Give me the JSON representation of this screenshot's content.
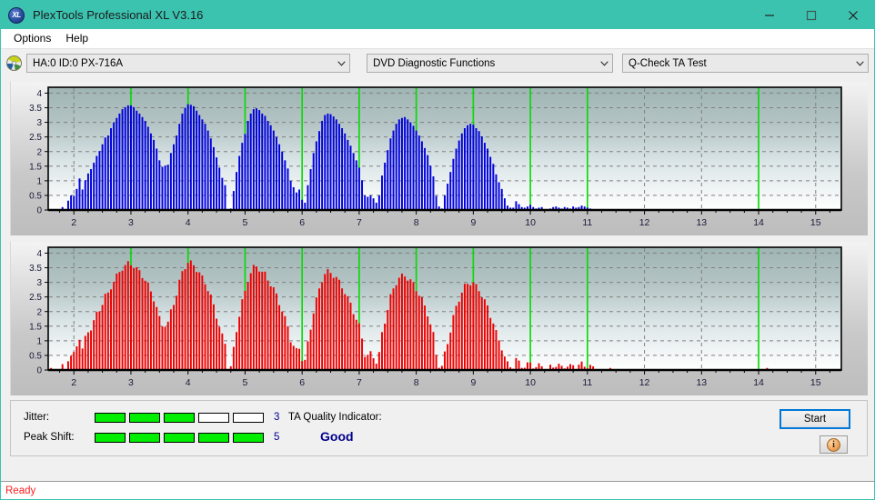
{
  "window": {
    "title": "PlexTools Professional XL V3.16",
    "app_icon": "xl-logo-icon",
    "minimize_label": "minimize-icon",
    "maximize_label": "maximize-icon",
    "close_label": "close-icon"
  },
  "menubar": {
    "items": [
      {
        "label": "Options"
      },
      {
        "label": "Help"
      }
    ]
  },
  "toolbar": {
    "drive_icon": "disc-icon",
    "drive": {
      "value": "HA:0 ID:0  PX-716A"
    },
    "function": {
      "value": "DVD Diagnostic Functions"
    },
    "test": {
      "value": "Q-Check TA Test"
    }
  },
  "results": {
    "jitter_label": "Jitter:",
    "jitter_value": "3",
    "jitter_filled": 3,
    "jitter_total": 5,
    "peak_shift_label": "Peak Shift:",
    "peak_shift_value": "5",
    "peak_shift_filled": 5,
    "peak_shift_total": 5,
    "ta_quality_label": "TA Quality Indicator:",
    "ta_quality_value": "Good",
    "start_label": "Start",
    "info_label": "i",
    "bar_on_color": "#00ee00",
    "bar_off_color": "#ffffff",
    "value_color": "#00008b"
  },
  "statusbar": {
    "text": "Ready"
  },
  "chart_data": [
    {
      "id": "ta-test-top",
      "type": "bar",
      "title": "",
      "xlabel": "",
      "ylabel": "",
      "series_color": "#0000dd",
      "marker_color": "#00dd00",
      "markers": [
        3,
        4,
        5,
        6,
        7,
        8,
        9,
        10,
        11,
        14
      ],
      "grid": true,
      "xlim": [
        1.55,
        15.45
      ],
      "ylim": [
        0,
        4.2
      ],
      "xticks": [
        2,
        3,
        4,
        5,
        6,
        7,
        8,
        9,
        10,
        11,
        12,
        13,
        14,
        15
      ],
      "yticks": [
        0,
        0.5,
        1,
        1.5,
        2,
        2.5,
        3,
        3.5,
        4
      ],
      "ytick_labels": [
        "0",
        "0.5",
        "1",
        "1.5",
        "2",
        "2.5",
        "3",
        "3.5",
        "4"
      ],
      "x": [
        1.6,
        1.65,
        1.7,
        1.75,
        1.8,
        1.85,
        1.9,
        1.95,
        2.0,
        2.05,
        2.1,
        2.15,
        2.2,
        2.25,
        2.3,
        2.35,
        2.4,
        2.45,
        2.5,
        2.55,
        2.6,
        2.65,
        2.7,
        2.75,
        2.8,
        2.85,
        2.9,
        2.95,
        3.0,
        3.05,
        3.1,
        3.15,
        3.2,
        3.25,
        3.3,
        3.35,
        3.4,
        3.45,
        3.5,
        3.55,
        3.6,
        3.65,
        3.7,
        3.75,
        3.8,
        3.85,
        3.9,
        3.95,
        4.0,
        4.05,
        4.1,
        4.15,
        4.2,
        4.25,
        4.3,
        4.35,
        4.4,
        4.45,
        4.5,
        4.55,
        4.6,
        4.65,
        4.7,
        4.75,
        4.8,
        4.85,
        4.9,
        4.95,
        5.0,
        5.05,
        5.1,
        5.15,
        5.2,
        5.25,
        5.3,
        5.35,
        5.4,
        5.45,
        5.5,
        5.55,
        5.6,
        5.65,
        5.7,
        5.75,
        5.8,
        5.85,
        5.9,
        5.95,
        6.0,
        6.05,
        6.1,
        6.15,
        6.2,
        6.25,
        6.3,
        6.35,
        6.4,
        6.45,
        6.5,
        6.55,
        6.6,
        6.65,
        6.7,
        6.75,
        6.8,
        6.85,
        6.9,
        6.95,
        7.0,
        7.05,
        7.1,
        7.15,
        7.2,
        7.25,
        7.3,
        7.35,
        7.4,
        7.45,
        7.5,
        7.55,
        7.6,
        7.65,
        7.7,
        7.75,
        7.8,
        7.85,
        7.9,
        7.95,
        8.0,
        8.05,
        8.1,
        8.15,
        8.2,
        8.25,
        8.3,
        8.35,
        8.4,
        8.45,
        8.5,
        8.55,
        8.6,
        8.65,
        8.7,
        8.75,
        8.8,
        8.85,
        8.9,
        8.95,
        9.0,
        9.05,
        9.1,
        9.15,
        9.2,
        9.25,
        9.3,
        9.35,
        9.4,
        9.45,
        9.5,
        9.55,
        9.6,
        9.65,
        9.7,
        9.75,
        9.8,
        9.85,
        9.9,
        9.95,
        10.0,
        10.05,
        10.1,
        10.15,
        10.2,
        10.25,
        10.3,
        10.35,
        10.4,
        10.45,
        10.5,
        10.55,
        10.6,
        10.65,
        10.7,
        10.75,
        10.8,
        10.85,
        10.9,
        10.95,
        11.0,
        11.05,
        11.1,
        11.15,
        11.2,
        11.25,
        11.3,
        11.35,
        11.4,
        13.85,
        13.9,
        13.95,
        14.0,
        14.05,
        14.1,
        14.15,
        14.2
      ],
      "values": [
        0,
        0,
        0,
        0,
        0.1,
        0.0,
        0.32,
        0.5,
        0.48,
        0.72,
        1.08,
        0.7,
        1.02,
        1.25,
        1.4,
        1.62,
        1.85,
        2.02,
        2.25,
        2.48,
        2.55,
        2.8,
        3.0,
        3.15,
        3.3,
        3.45,
        3.52,
        3.58,
        3.58,
        3.52,
        3.4,
        3.3,
        3.18,
        3.05,
        2.85,
        2.62,
        2.4,
        2.1,
        1.7,
        1.48,
        1.52,
        1.55,
        1.95,
        2.25,
        2.55,
        2.95,
        3.3,
        3.5,
        3.62,
        3.6,
        3.55,
        3.4,
        3.25,
        3.1,
        2.95,
        2.72,
        2.45,
        2.15,
        1.8,
        1.45,
        1.1,
        0.85,
        0.0,
        0.05,
        0.65,
        1.3,
        1.85,
        2.3,
        2.6,
        3.05,
        3.3,
        3.45,
        3.48,
        3.42,
        3.3,
        3.22,
        3.05,
        2.9,
        2.72,
        2.5,
        2.25,
        2.0,
        1.7,
        1.42,
        1.0,
        0.78,
        0.6,
        0.7,
        0.35,
        0.25,
        0.85,
        1.4,
        1.95,
        2.35,
        2.7,
        3.05,
        3.25,
        3.3,
        3.28,
        3.2,
        3.1,
        2.95,
        2.8,
        2.62,
        2.4,
        2.2,
        1.95,
        1.7,
        1.45,
        1.02,
        0.5,
        0.45,
        0.5,
        0.4,
        0.25,
        0.5,
        1.18,
        1.62,
        2.05,
        2.45,
        2.72,
        2.95,
        3.1,
        3.15,
        3.18,
        3.1,
        3.0,
        2.88,
        2.72,
        2.55,
        2.35,
        2.12,
        1.88,
        1.52,
        1.15,
        0.48,
        0.12,
        0.05,
        0.5,
        0.9,
        1.3,
        1.75,
        2.1,
        2.38,
        2.62,
        2.8,
        2.9,
        2.95,
        2.92,
        2.8,
        2.7,
        2.52,
        2.3,
        2.1,
        1.82,
        1.58,
        1.22,
        0.95,
        0.72,
        0.4,
        0.15,
        0.08,
        0.08,
        0.3,
        0.2,
        0.1,
        0.08,
        0.12,
        0.18,
        0.1,
        0.05,
        0.08,
        0.1,
        0.0,
        0.0,
        0.05,
        0.1,
        0.12,
        0.08,
        0.05,
        0.1,
        0.08,
        0.05,
        0.12,
        0.08,
        0.1,
        0.15,
        0.12,
        0.08,
        0.05,
        0.02,
        0.0,
        0.0,
        0.0,
        0.0,
        0.0,
        0.0,
        0.0,
        0.0,
        0.0,
        0.0,
        0.0,
        0.0,
        0.0,
        0.0,
        0.0,
        0.0,
        0.0,
        0.0,
        0.0,
        0.0,
        0.0,
        0.0,
        0.0,
        0.0,
        0.0,
        0.0,
        0.0,
        0.0
      ]
    },
    {
      "id": "ta-test-bottom",
      "type": "bar",
      "title": "",
      "xlabel": "",
      "ylabel": "",
      "series_color": "#ee0000",
      "marker_color": "#00dd00",
      "markers": [
        3,
        4,
        5,
        6,
        7,
        8,
        9,
        10,
        11,
        14
      ],
      "grid": true,
      "xlim": [
        1.55,
        15.45
      ],
      "ylim": [
        0,
        4.2
      ],
      "xticks": [
        2,
        3,
        4,
        5,
        6,
        7,
        8,
        9,
        10,
        11,
        12,
        13,
        14,
        15
      ],
      "yticks": [
        0,
        0.5,
        1,
        1.5,
        2,
        2.5,
        3,
        3.5,
        4
      ],
      "ytick_labels": [
        "0",
        "0.5",
        "1",
        "1.5",
        "2",
        "2.5",
        "3",
        "3.5",
        "4"
      ]
    }
  ]
}
